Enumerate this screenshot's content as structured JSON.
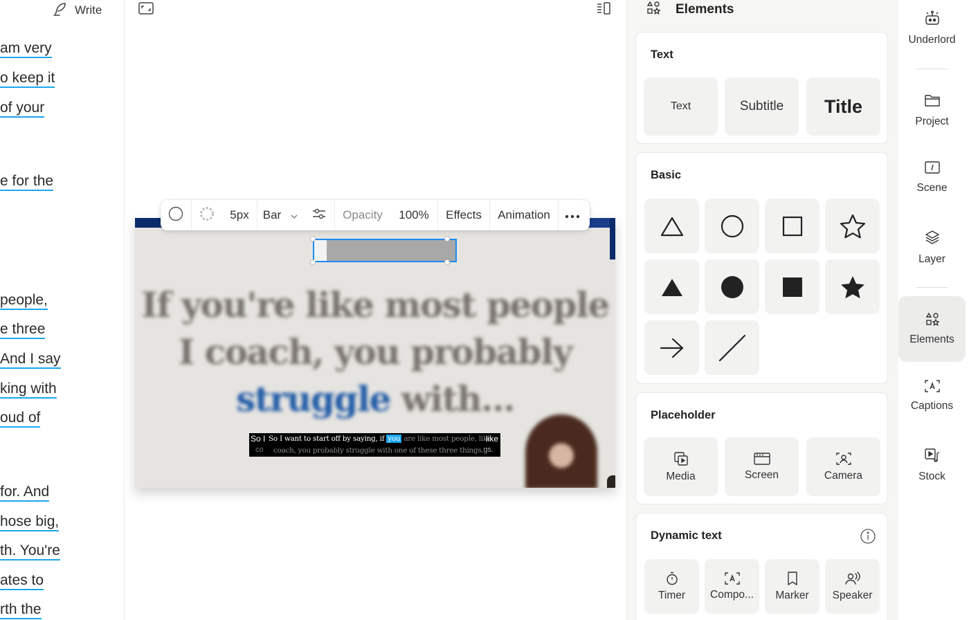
{
  "script": {
    "write_label": "Write",
    "lines": [
      {
        "text": "am very "
      },
      {
        "text": "o keep it "
      },
      {
        "text": "of your "
      },
      {
        "text": "e for the "
      },
      {
        "text": "people, "
      },
      {
        "text": "e three "
      },
      {
        "text": "And I say "
      },
      {
        "text": "king with "
      },
      {
        "text": "oud of "
      },
      {
        "text": "for. And "
      },
      {
        "text": "hose big, "
      },
      {
        "text": "th. You're "
      },
      {
        "text": "ates to "
      },
      {
        "text": "rth the "
      }
    ]
  },
  "canvas": {
    "headline": {
      "line1": "If you're like most people",
      "line2": "I coach, you probably",
      "accent": "struggle",
      "rest": " with..."
    },
    "caption": {
      "edge_left_top": "So I",
      "edge_left_bottom": "co",
      "edge_right_top": "like",
      "edge_right_bottom": "gs.",
      "before": "So I want to start off by saying, if ",
      "highlight": "you",
      "after": " are like most people, like",
      "line2": "coach, you probably struggle with one of these three things."
    },
    "toolbar": {
      "stroke_width": "5px",
      "style": "Bar",
      "opacity_label": "Opacity",
      "opacity_value": "100%",
      "effects": "Effects",
      "animation": "Animation"
    }
  },
  "elements": {
    "title": "Elements",
    "text_section": {
      "title": "Text",
      "items": [
        "Text",
        "Subtitle",
        "Title"
      ]
    },
    "basic_section": {
      "title": "Basic"
    },
    "placeholder_section": {
      "title": "Placeholder",
      "items": [
        "Media",
        "Screen",
        "Camera"
      ]
    },
    "dynamic_section": {
      "title": "Dynamic text",
      "items": [
        "Timer",
        "Compo...",
        "Marker",
        "Speaker"
      ]
    }
  },
  "rail": {
    "items": [
      "Underlord",
      "Project",
      "Scene",
      "Layer",
      "Elements",
      "Captions",
      "Stock"
    ],
    "active": "Elements"
  }
}
